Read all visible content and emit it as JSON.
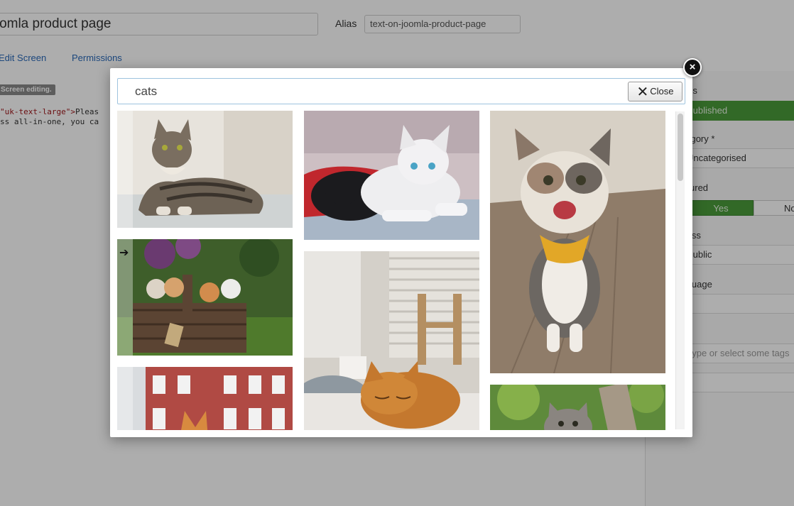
{
  "editor": {
    "title_value": "Joomla product page",
    "alias_label": "Alias",
    "alias_value": "text-on-joomla-product-page",
    "tabs": [
      "Site Edit Screen",
      "Permissions"
    ],
    "badge": "Screen editing.",
    "code_lines": [
      {
        "prefix": "\"uk-text-large\">",
        "rest": "Pleas"
      },
      {
        "prefix": "",
        "rest": "ss all-in-one, you ca"
      }
    ]
  },
  "sidebar": {
    "status_label": "Status",
    "status_value": "Published",
    "category_label": "Category *",
    "category_value": "Uncategorised",
    "featured_label": "Featured",
    "featured_yes": "Yes",
    "featured_no": "No",
    "access_label": "Access",
    "access_value": "Public",
    "language_label": "Language",
    "tags_placeholder": "Type or select some tags"
  },
  "modal": {
    "search_value": "cats",
    "close_label": "Close",
    "close_circle_glyph": "×",
    "results": [
      {
        "subject": "tabby cat on sofa"
      },
      {
        "subject": "white kitten and black kitten"
      },
      {
        "subject": "smiling cat with yellow bandana"
      },
      {
        "subject": "kittens in a basket"
      },
      {
        "subject": "sleeping ginger cat by window"
      },
      {
        "subject": "cat in front of brick building"
      },
      {
        "subject": "kitten in tree"
      }
    ]
  },
  "colors": {
    "published_green": "#4a9b3a",
    "link_blue": "#2a69b8",
    "search_border": "#9ec3de"
  }
}
